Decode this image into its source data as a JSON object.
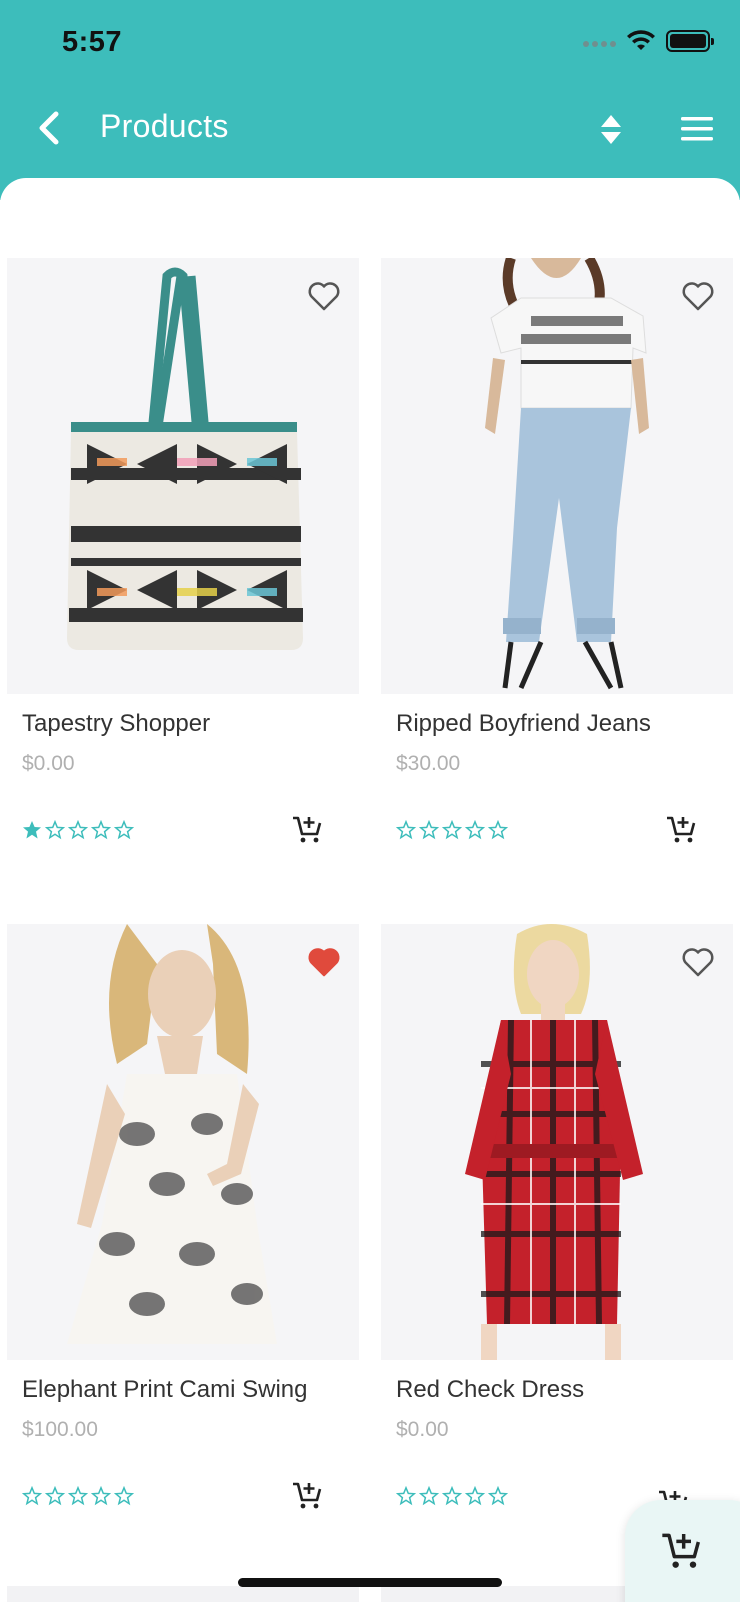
{
  "status_bar": {
    "time": "5:57"
  },
  "header": {
    "title": "Products",
    "accent_color": "#3dbdbb"
  },
  "products": [
    {
      "name": "Tapestry Shopper",
      "price": "$0.00",
      "rating": 1,
      "favorite": false,
      "image": "tote-bag"
    },
    {
      "name": "Ripped Boyfriend Jeans",
      "price": "$30.00",
      "rating": 0,
      "favorite": false,
      "image": "jeans-outfit"
    },
    {
      "name": "Elephant Print Cami Swing",
      "price": "$100.00",
      "rating": 0,
      "favorite": true,
      "image": "elephant-dress"
    },
    {
      "name": "Red Check Dress",
      "price": "$0.00",
      "rating": 0,
      "favorite": false,
      "image": "red-check-dress"
    }
  ],
  "icons": {
    "back": "chevron-left-icon",
    "sort": "sort-icon",
    "menu": "hamburger-menu-icon",
    "favorite": "heart-icon",
    "cart": "add-to-cart-icon"
  },
  "colors": {
    "star": "#3dbdbb",
    "heart_active": "#e04a3c"
  }
}
